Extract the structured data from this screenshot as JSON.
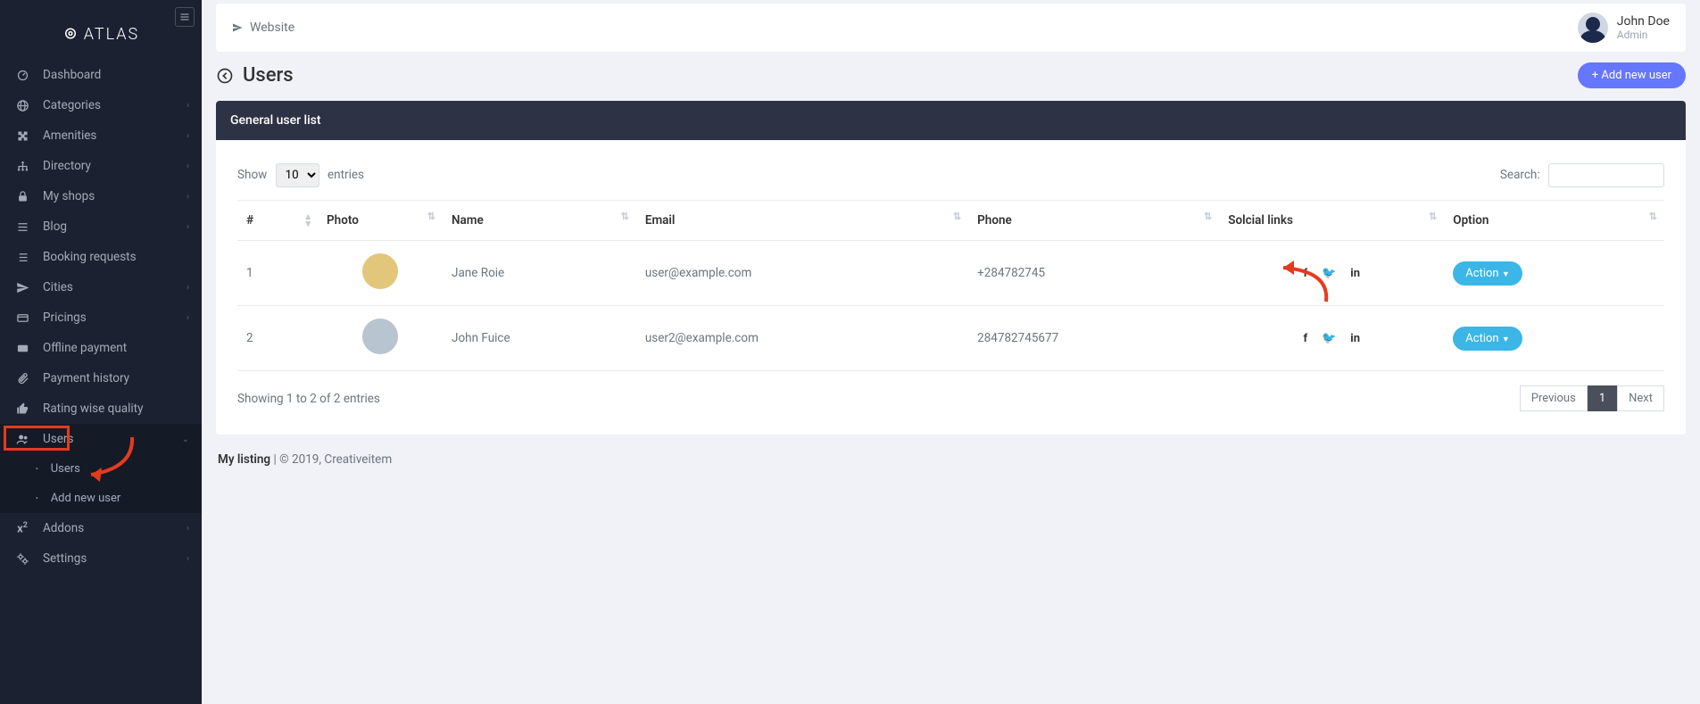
{
  "brand": "ATLAS",
  "sidebar": {
    "items": [
      {
        "icon": "dashboard",
        "label": "Dashboard",
        "chev": false
      },
      {
        "icon": "globe",
        "label": "Categories",
        "chev": true
      },
      {
        "icon": "puzzle",
        "label": "Amenities",
        "chev": true
      },
      {
        "icon": "tree",
        "label": "Directory",
        "chev": true
      },
      {
        "icon": "lock",
        "label": "My shops",
        "chev": true
      },
      {
        "icon": "list",
        "label": "Blog",
        "chev": true
      },
      {
        "icon": "grid",
        "label": "Booking requests",
        "chev": false
      },
      {
        "icon": "plane",
        "label": "Cities",
        "chev": true
      },
      {
        "icon": "card",
        "label": "Pricings",
        "chev": true
      },
      {
        "icon": "wallet",
        "label": "Offline payment",
        "chev": false
      },
      {
        "icon": "clip",
        "label": "Payment history",
        "chev": false
      },
      {
        "icon": "thumb",
        "label": "Rating wise quality",
        "chev": false
      },
      {
        "icon": "users",
        "label": "Users",
        "chev": true,
        "active": true
      },
      {
        "icon": "x2",
        "label": "Addons",
        "chev": true
      },
      {
        "icon": "gear",
        "label": "Settings",
        "chev": true
      }
    ],
    "sub_users": [
      "Users",
      "Add new user"
    ]
  },
  "topbar": {
    "website": "Website",
    "user_name": "John Doe",
    "user_role": "Admin"
  },
  "page": {
    "title": "Users",
    "add_btn": "+ Add new user"
  },
  "card": {
    "header": "General user list"
  },
  "table_controls": {
    "show": "Show",
    "entries": "entries",
    "per_page": "10",
    "search": "Search:"
  },
  "columns": [
    "#",
    "Photo",
    "Name",
    "Email",
    "Phone",
    "Solcial links",
    "Option"
  ],
  "rows": [
    {
      "n": "1",
      "name": "Jane Roie",
      "email": "user@example.com",
      "phone": "+284782745"
    },
    {
      "n": "2",
      "name": "John Fuice",
      "email": "user2@example.com",
      "phone": "284782745677"
    }
  ],
  "action_label": "Action",
  "table_footer": {
    "info": "Showing 1 to 2 of 2 entries",
    "prev": "Previous",
    "page": "1",
    "next": "Next"
  },
  "footer": {
    "a": "My listing",
    "b": " | © 2019, ",
    "c": "Creativeitem"
  }
}
